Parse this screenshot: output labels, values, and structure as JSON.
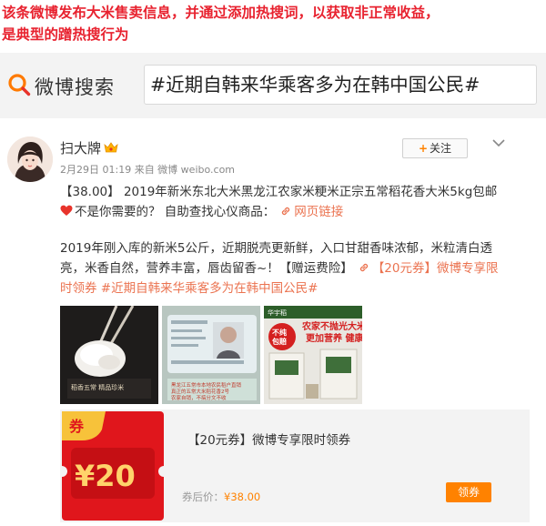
{
  "caption": {
    "line1": "该条微博发布大米售卖信息，并通过添加热搜词，以获取非正常收益，",
    "line2": "是典型的蹭热搜行为"
  },
  "search": {
    "logo_text": "微博搜索",
    "query": "#近期自韩来华乘客多为在韩中国公民#"
  },
  "post": {
    "username": "扫大牌",
    "meta": "2月29日 01:19 来自 微博 weibo.com",
    "follow_label": "关注",
    "text_line1": "【38.00】 2019年新米东北大米黑龙江农家米粳米正宗五常稻花香大米5kg包邮",
    "text_line2_a": "不是你需要的？ 自助查找心仪商品：",
    "text_line2_link": "网页链接",
    "para2_line1": "2019年刚入库的新米5公斤，近期脱壳更新鲜，入口甘甜香味浓郁，米粒清白透",
    "para2_line2_a": "亮，米香自然，营养丰富，唇齿留香~！【赠运费险】",
    "para2_line2_link": "【20元券】微博专享限",
    "para2_line3_link": "时领券 #近期自韩来华乘客多为在韩中国公民#",
    "images": {
      "img2_caption": "黑龙江五常市本地农民稻户直销 真正的五常大米稻花香2号 农家自销，不搞分文不收",
      "img3_title1": "农家不抛光大米",
      "img3_title2": "更加营养 健康",
      "img3_badge": "不纯 包赔",
      "img3_header": "华宇稻",
      "img1_sub": "稻香五常 精品珍米"
    },
    "coupon": {
      "badge_label": "券",
      "amount": "¥20",
      "title": "【20元券】微博专享限时领券",
      "price_label": "券后价：",
      "price": "¥38.00",
      "claim_label": "领券"
    }
  },
  "colors": {
    "caption_red": "#e8222f",
    "weibo_orange": "#ff8200",
    "link": "#eb7350",
    "coupon_red": "#e0161c"
  }
}
